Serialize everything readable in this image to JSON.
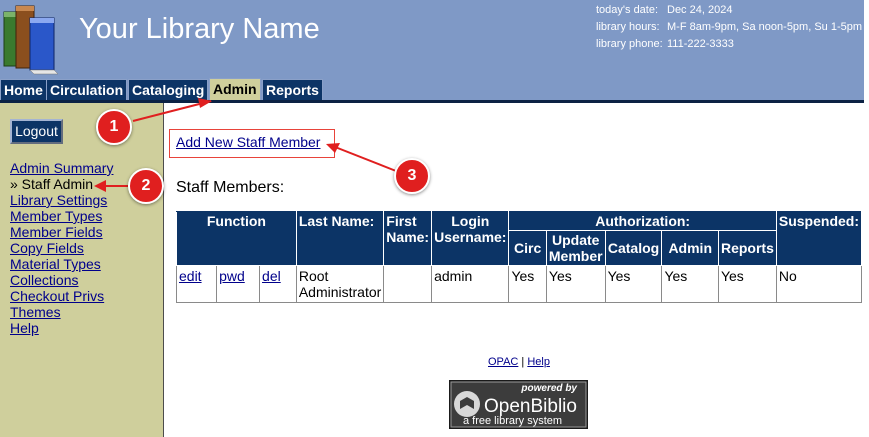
{
  "header": {
    "library_name": "Your Library Name",
    "date_label": "today's date:",
    "date_value": "Dec 24, 2024",
    "hours_label": "library hours:",
    "hours_value": "M-F 8am-9pm, Sa noon-5pm, Su 1-5pm",
    "phone_label": "library phone:",
    "phone_value": "111-222-3333"
  },
  "tabs": [
    {
      "label": "Home",
      "active": false
    },
    {
      "label": "Circulation",
      "active": false
    },
    {
      "label": "Cataloging",
      "active": false
    },
    {
      "label": "Admin",
      "active": true
    },
    {
      "label": "Reports",
      "active": false
    }
  ],
  "sidebar": {
    "logout_label": "Logout",
    "items": [
      {
        "label": "Admin Summary"
      },
      {
        "label": "» Staff Admin",
        "current": true
      },
      {
        "label": "Library Settings"
      },
      {
        "label": "Member Types"
      },
      {
        "label": "Member Fields"
      },
      {
        "label": "Copy Fields"
      },
      {
        "label": "Material Types"
      },
      {
        "label": "Collections"
      },
      {
        "label": "Checkout Privs"
      },
      {
        "label": "Themes"
      },
      {
        "label": "Help"
      }
    ]
  },
  "main": {
    "add_link": "Add New Staff Member",
    "heading": "Staff Members:",
    "table": {
      "headers": {
        "function": "Function",
        "last_name": "Last Name:",
        "first_name": "First Name:",
        "login": "Login Username:",
        "authorization": "Authorization:",
        "suspended": "Suspended:",
        "circ": "Circ",
        "update_member": "Update Member",
        "catalog": "Catalog",
        "admin": "Admin",
        "reports": "Reports"
      },
      "rows": [
        {
          "edit": "edit",
          "pwd": "pwd",
          "del": "del",
          "last_name": "Root Administrator",
          "first_name": "",
          "login": "admin",
          "circ": "Yes",
          "update_member": "Yes",
          "catalog": "Yes",
          "admin": "Yes",
          "reports": "Yes",
          "suspended": "No"
        }
      ]
    }
  },
  "footer": {
    "opac": "OPAC",
    "separator": "|",
    "help": "Help",
    "powered_by": "powered by",
    "brand": "OpenBiblio",
    "tagline": "a free library system"
  },
  "annotations": {
    "markers": [
      "1",
      "2",
      "3"
    ],
    "color": "#e01f1f"
  },
  "colors": {
    "header_bg": "#7f99c6",
    "tab_bg": "#0c3466",
    "active_tab_bg": "#cfcf9c",
    "sidebar_bg": "#cfcf9c",
    "link": "#00008b"
  }
}
